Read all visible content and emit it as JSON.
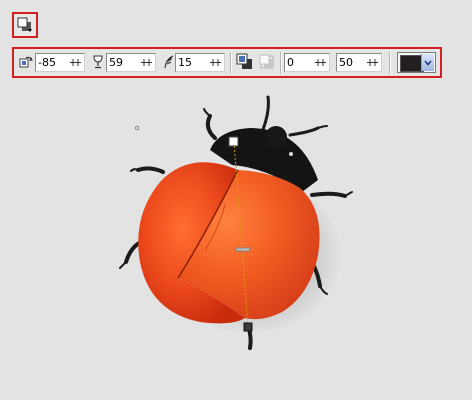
{
  "toolbar": {
    "tool_icon": "blend-tool-icon",
    "options": {
      "rotation_value": "-85",
      "rotation_icon": "rotate-layer-icon",
      "opacity_value": "59",
      "opacity_icon": "wineglass-opacity-icon",
      "softness_value": "15",
      "softness_icon": "feather-icon",
      "offset_value": "0",
      "offset_mode_icons": [
        "drop-shadow-icon",
        "inner-shadow-icon"
      ],
      "size_value": "50",
      "shadow_color": "#231f20"
    }
  },
  "colors": {
    "highlight_border": "#d21f1f",
    "shell_red": "#e8401a",
    "body_black": "#151515"
  }
}
